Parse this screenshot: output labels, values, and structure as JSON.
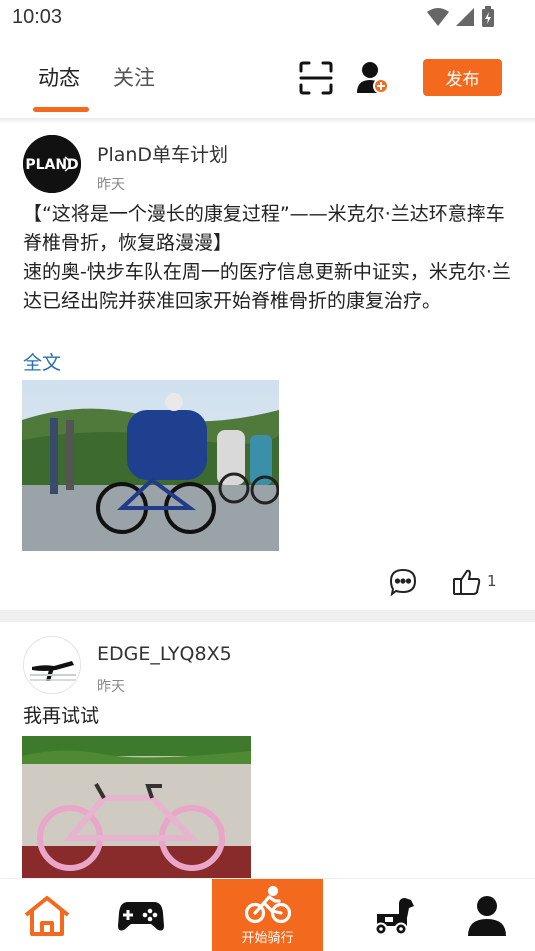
{
  "status_bar": {
    "time": "10:03"
  },
  "header": {
    "tabs": [
      {
        "label": "动态",
        "active": true
      },
      {
        "label": "关注",
        "active": false
      }
    ],
    "scan_icon": "scan-icon",
    "add_user_icon": "add-user-icon",
    "publish_label": "发布",
    "accent_color": "#f36a1e"
  },
  "posts": [
    {
      "username": "PlanD单车计划",
      "time": "昨天",
      "avatar_text": "PLAND",
      "title": "【“这将是一个漫长的康复过程”——米克尔·兰达环意摔车脊椎骨折，恢复路漫漫】",
      "body": "速的奥-快步车队在周一的医疗信息更新中证实，米克尔·兰达已经出院并获准回家开始脊椎骨折的康复治疗。",
      "full_text_link": "全文",
      "like_count": "1"
    },
    {
      "username": "EDGE_LYQ8X5",
      "time": "昨天",
      "body": "我再试试"
    }
  ],
  "bottom_nav": {
    "items": [
      {
        "icon": "home-icon",
        "active": true
      },
      {
        "icon": "gamepad-icon"
      },
      {
        "icon": "bicycle-icon",
        "label": "开始骑行"
      },
      {
        "icon": "horse-icon"
      },
      {
        "icon": "profile-icon"
      }
    ]
  }
}
